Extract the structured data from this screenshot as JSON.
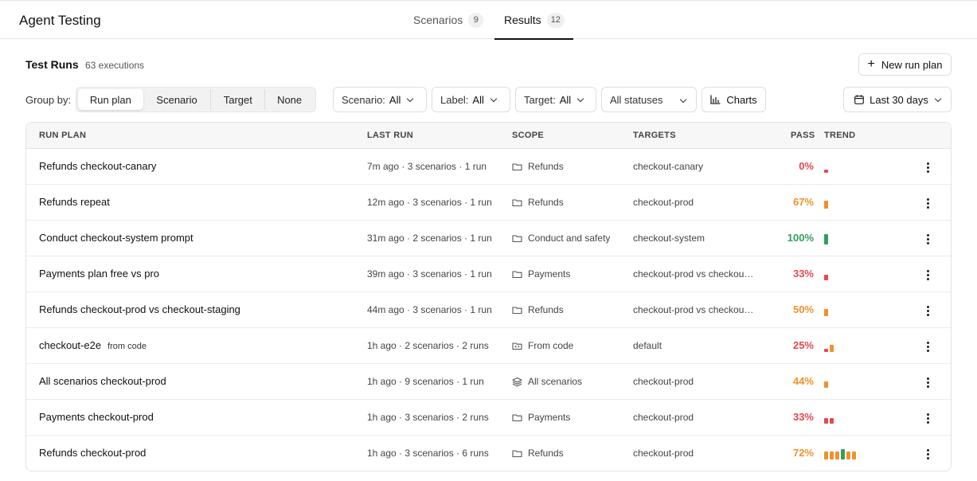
{
  "app": {
    "title": "Agent Testing"
  },
  "tabs": [
    {
      "label": "Scenarios",
      "count": "9"
    },
    {
      "label": "Results",
      "count": "12"
    }
  ],
  "section": {
    "title": "Test Runs",
    "subtitle": "63 executions",
    "new_button": "New run plan"
  },
  "toolbar": {
    "group_by_label": "Group by:",
    "group_options": [
      "Run plan",
      "Scenario",
      "Target",
      "None"
    ],
    "filters": {
      "scenario": {
        "key": "Scenario:",
        "value": "All"
      },
      "label": {
        "key": "Label:",
        "value": "All"
      },
      "target": {
        "key": "Target:",
        "value": "All"
      },
      "status": {
        "value": "All statuses"
      }
    },
    "charts_label": "Charts",
    "date_range": "Last 30 days"
  },
  "table": {
    "headers": {
      "run_plan": "RUN PLAN",
      "last_run": "LAST RUN",
      "scope": "SCOPE",
      "targets": "TARGETS",
      "pass": "PASS",
      "trend": "TREND"
    },
    "rows": [
      {
        "name": "Refunds checkout-canary",
        "tag": "",
        "last_run": "7m ago · 3 scenarios · 1 run",
        "scope_icon": "folder-icon",
        "scope": "Refunds",
        "targets": "checkout-canary",
        "pass": "0%",
        "pass_color": "#e5484d",
        "trend": [
          0
        ]
      },
      {
        "name": "Refunds repeat",
        "tag": "",
        "last_run": "12m ago · 3 scenarios · 1 run",
        "scope_icon": "folder-icon",
        "scope": "Refunds",
        "targets": "checkout-prod",
        "pass": "67%",
        "pass_color": "#f0912c",
        "trend": [
          67
        ]
      },
      {
        "name": "Conduct checkout-system prompt",
        "tag": "",
        "last_run": "31m ago · 2 scenarios · 1 run",
        "scope_icon": "folder-icon",
        "scope": "Conduct and safety",
        "targets": "checkout-system",
        "pass": "100%",
        "pass_color": "#2f9e5c",
        "trend": [
          100
        ]
      },
      {
        "name": "Payments plan free vs pro",
        "tag": "",
        "last_run": "39m ago · 3 scenarios · 1 run",
        "scope_icon": "folder-icon",
        "scope": "Payments",
        "targets": "checkout-prod vs checkout-...",
        "pass": "33%",
        "pass_color": "#e5484d",
        "trend": [
          33
        ]
      },
      {
        "name": "Refunds checkout-prod vs checkout-staging",
        "tag": "",
        "last_run": "44m ago · 3 scenarios · 1 run",
        "scope_icon": "folder-icon",
        "scope": "Refunds",
        "targets": "checkout-prod vs checkout-...",
        "pass": "50%",
        "pass_color": "#f0912c",
        "trend": [
          50
        ]
      },
      {
        "name": "checkout-e2e",
        "tag": "from code",
        "last_run": "1h ago · 2 scenarios · 2 runs",
        "scope_icon": "code-folder-icon",
        "scope": "From code",
        "targets": "default",
        "pass": "25%",
        "pass_color": "#e5484d",
        "trend": [
          0,
          50
        ]
      },
      {
        "name": "All scenarios checkout-prod",
        "tag": "",
        "last_run": "1h ago · 9 scenarios · 1 run",
        "scope_icon": "layers-icon",
        "scope": "All scenarios",
        "targets": "checkout-prod",
        "pass": "44%",
        "pass_color": "#f0912c",
        "trend": [
          44
        ]
      },
      {
        "name": "Payments checkout-prod",
        "tag": "",
        "last_run": "1h ago · 3 scenarios · 2 runs",
        "scope_icon": "folder-icon",
        "scope": "Payments",
        "targets": "checkout-prod",
        "pass": "33%",
        "pass_color": "#e5484d",
        "trend": [
          33,
          33
        ]
      },
      {
        "name": "Refunds checkout-prod",
        "tag": "",
        "last_run": "1h ago · 3 scenarios · 6 runs",
        "scope_icon": "folder-icon",
        "scope": "Refunds",
        "targets": "checkout-prod",
        "pass": "72%",
        "pass_color": "#f0912c",
        "trend": [
          67,
          67,
          67,
          100,
          67,
          67
        ]
      }
    ]
  },
  "colors": {
    "fail": "#e5484d",
    "warn": "#f0912c",
    "pass": "#2f9e5c"
  }
}
